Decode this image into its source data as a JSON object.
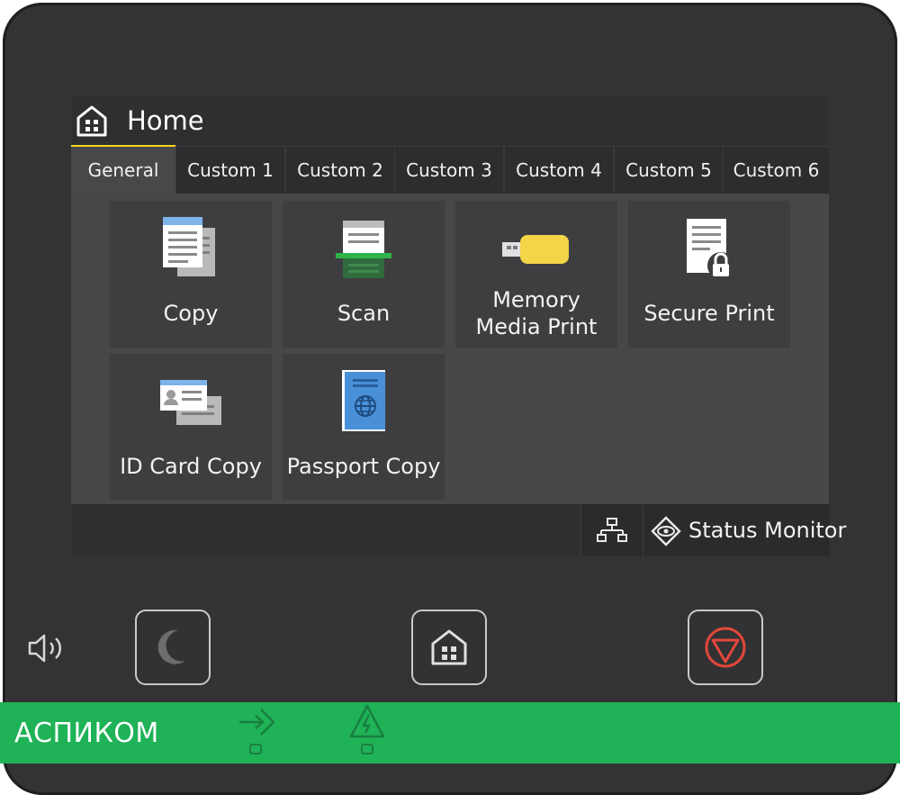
{
  "header": {
    "title": "Home"
  },
  "tabs": [
    {
      "label": "General"
    },
    {
      "label": "Custom 1"
    },
    {
      "label": "Custom 2"
    },
    {
      "label": "Custom 3"
    },
    {
      "label": "Custom 4"
    },
    {
      "label": "Custom 5"
    },
    {
      "label": "Custom 6"
    }
  ],
  "tiles": [
    {
      "label_lines": [
        "Copy"
      ],
      "icon": "copy-icon"
    },
    {
      "label_lines": [
        "Scan"
      ],
      "icon": "scan-icon"
    },
    {
      "label_lines": [
        "Memory",
        "Media Print"
      ],
      "icon": "usb-drive-icon"
    },
    {
      "label_lines": [
        "Secure Print"
      ],
      "icon": "secure-print-icon"
    },
    {
      "label_lines": [
        "ID Card Copy"
      ],
      "icon": "id-card-icon"
    },
    {
      "label_lines": [
        "Passport Copy"
      ],
      "icon": "passport-icon"
    }
  ],
  "footer": {
    "status_monitor": "Status Monitor"
  },
  "hardware": {
    "sleep_icon": "moon-icon",
    "home_icon": "home-icon",
    "stop_icon": "stop-icon",
    "volume_icon": "speaker-icon"
  },
  "watermark": {
    "text": "АСПИКОМ"
  },
  "colors": {
    "active_tab_underline": "#f3d31c",
    "stop_red": "#e2473a",
    "watermark_green": "#1fb257",
    "usb_yellow": "#f4d548",
    "scan_green": "#2fb34a",
    "passport_blue": "#4a90d9"
  }
}
